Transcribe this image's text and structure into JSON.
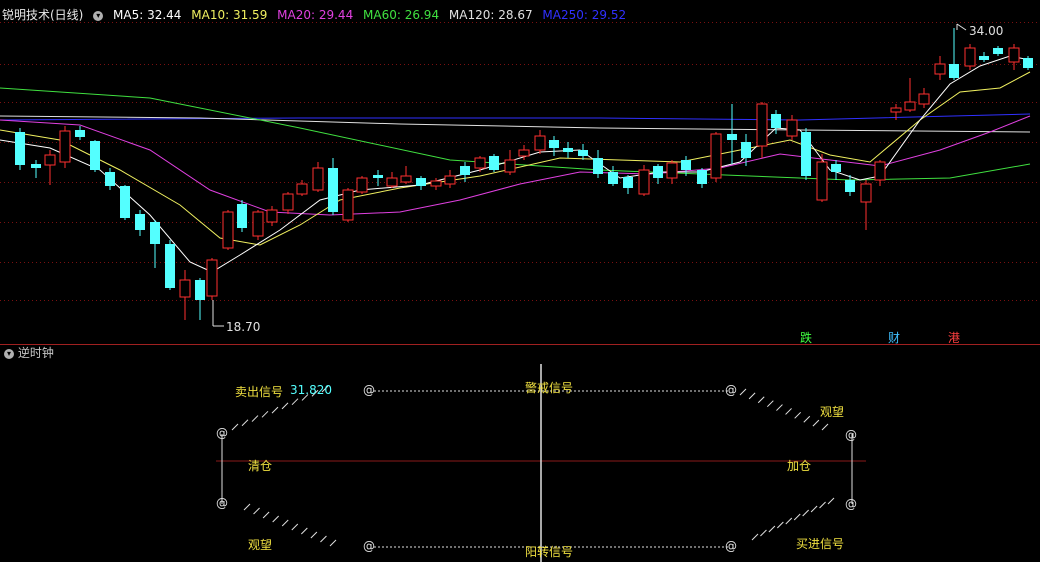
{
  "header": {
    "stock_name": "锐明技术(日线)",
    "collapse_icon": "chevron-down-icon",
    "ma": [
      {
        "label": "MA5: 32.44",
        "color": "#ffffff"
      },
      {
        "label": "MA10: 31.59",
        "color": "#f0f060"
      },
      {
        "label": "MA20: 29.44",
        "color": "#e040e0"
      },
      {
        "label": "MA60: 26.94",
        "color": "#40e040"
      },
      {
        "label": "MA120: 28.67",
        "color": "#e0e0e0"
      },
      {
        "label": "MA250: 29.52",
        "color": "#3030ff"
      }
    ]
  },
  "main_chart": {
    "high_label": "34.00",
    "low_label": "18.70",
    "up_color": "#ff3030",
    "down_color": "#54ffff",
    "badges": [
      {
        "text": "跌",
        "color": "#40ff40"
      },
      {
        "text": "财",
        "color": "#40c0ff"
      },
      {
        "text": "港",
        "color": "#ff4040"
      }
    ]
  },
  "indicator_panel": {
    "title": "逆时钟",
    "labels": {
      "sell_signal": "卖出信号",
      "sell_value": "31.820",
      "warning_signal": "警戒信号",
      "watch_top": "观望",
      "clear": "清仓",
      "add": "加仓",
      "watch_bottom": "观望",
      "bullish_signal": "阳转信号",
      "buy_signal": "买进信号",
      "node_symbol": "@"
    }
  }
}
